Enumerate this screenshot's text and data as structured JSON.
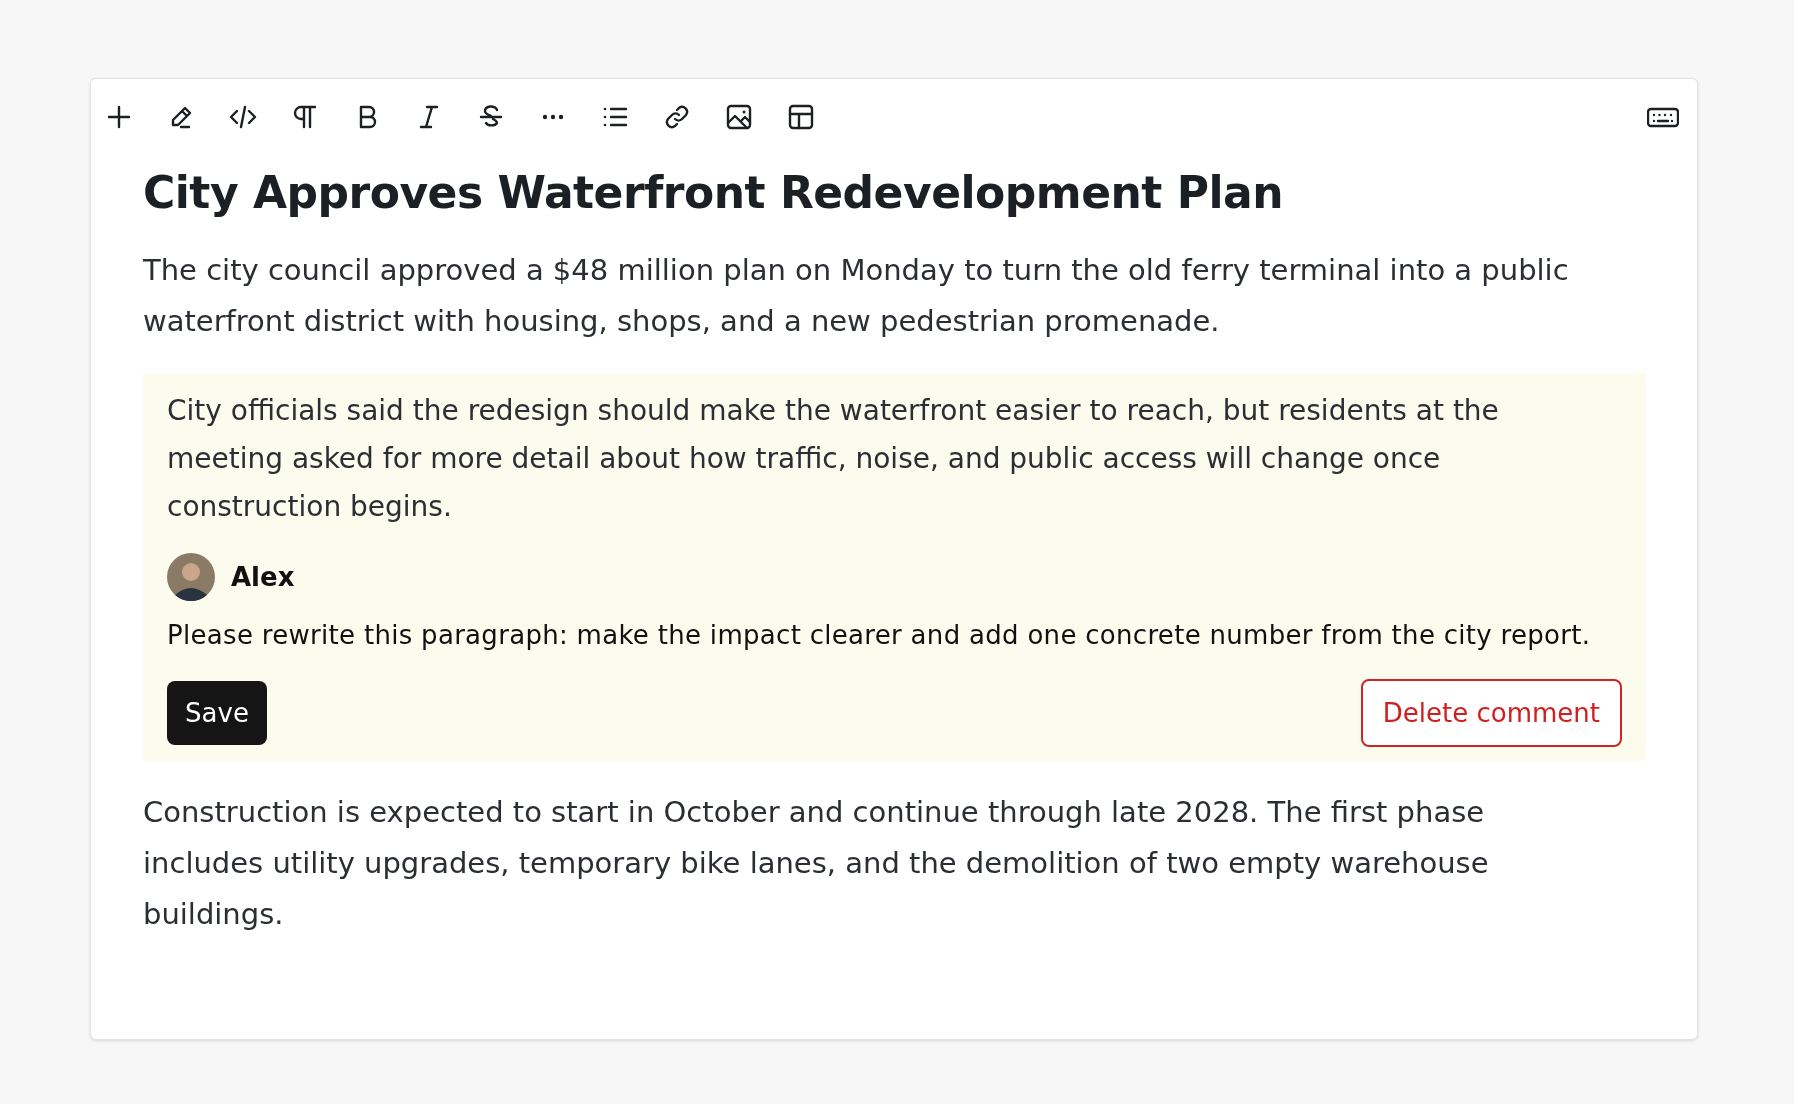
{
  "toolbar": {
    "tools": [
      {
        "kind": "plus"
      },
      {
        "kind": "pencil"
      },
      {
        "kind": "code"
      },
      {
        "kind": "paragraph"
      },
      {
        "kind": "bold"
      },
      {
        "kind": "italic"
      },
      {
        "kind": "strike"
      },
      {
        "kind": "more"
      },
      {
        "kind": "list"
      },
      {
        "kind": "link"
      },
      {
        "kind": "image"
      },
      {
        "kind": "table"
      }
    ],
    "right_tool": {
      "kind": "keyboard"
    }
  },
  "article": {
    "title": "City Approves Waterfront Redevelopment Plan",
    "paragraph_1": "The city council approved a $48 million plan on Monday to turn the old ferry terminal into a public waterfront district with housing, shops, and a new pedestrian promenade.",
    "commented_paragraph": "City officials said the redesign should make the waterfront easier to reach, but residents at the meeting asked for more detail about how traffic, noise, and public access will change once construction begins.",
    "comment": {
      "author": "Alex",
      "text": "Please rewrite this paragraph: make the impact clearer and add one concrete number from the city report.",
      "save_button": "Save",
      "delete_button": "Delete comment"
    },
    "paragraph_2": "Construction is expected to start in October and continue through late 2028. The first phase includes utility upgrades, temporary bike lanes, and the demolition of two empty warehouse buildings."
  }
}
